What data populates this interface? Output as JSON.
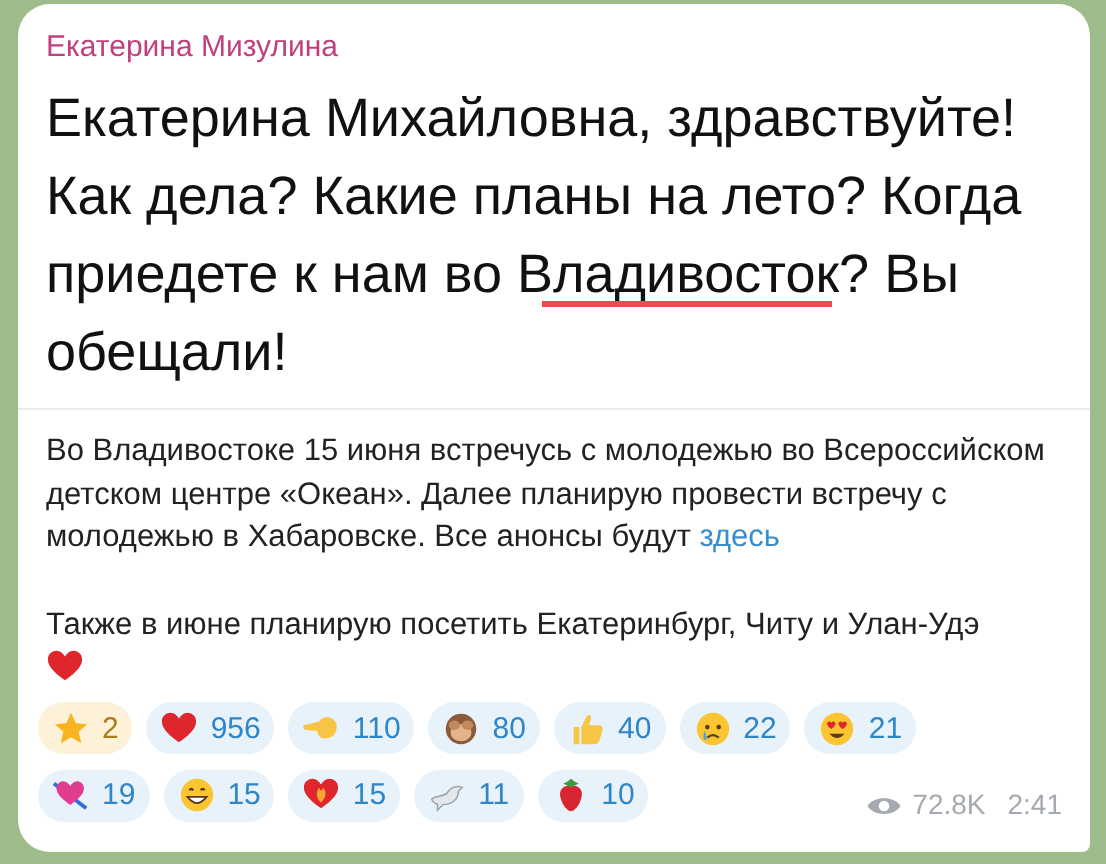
{
  "message": {
    "image": {
      "author": "Екатерина Мизулина",
      "lines": [
        {
          "segments": [
            {
              "text": "Екатерина Михайловна, здравствуйте!",
              "underlined": false
            }
          ]
        },
        {
          "segments": [
            {
              "text": "Как дела? Какие планы на лето? Когда",
              "underlined": false
            }
          ]
        },
        {
          "segments": [
            {
              "text": "приедете к нам во ",
              "underlined": false
            },
            {
              "text": "Владивосток",
              "underlined": true
            },
            {
              "text": "? Вы",
              "underlined": false
            }
          ]
        },
        {
          "segments": [
            {
              "text": "обещали!",
              "underlined": false
            }
          ]
        }
      ]
    },
    "paragraphs": [
      {
        "text": "Во Владивостоке 15 июня встречусь с молодежью во Всероссийском детском центре «Океан». Далее планирую провести встречу с молодежью в Хабаровске. Все анонсы будут",
        "link": "здесь",
        "heart": false
      },
      {
        "text": "Также в июне планирую посетить Екатеринбург, Читу и Улан-Удэ",
        "heart": true
      }
    ],
    "reactions": [
      {
        "kind": "paid",
        "count": "2"
      },
      {
        "kind": "emoji",
        "count": "956"
      },
      {
        "kind": "emoji",
        "count": "110"
      },
      {
        "kind": "emoji",
        "count": "80"
      },
      {
        "kind": "emoji",
        "count": "40"
      },
      {
        "kind": "emoji",
        "count": "22"
      },
      {
        "kind": "emoji",
        "count": "21"
      },
      {
        "kind": "emoji",
        "count": "19"
      },
      {
        "kind": "emoji",
        "count": "15"
      },
      {
        "kind": "emoji",
        "count": "15"
      },
      {
        "kind": "emoji",
        "count": "11"
      },
      {
        "kind": "emoji",
        "count": "10"
      }
    ],
    "views": "72.8K",
    "time": "2:41"
  }
}
